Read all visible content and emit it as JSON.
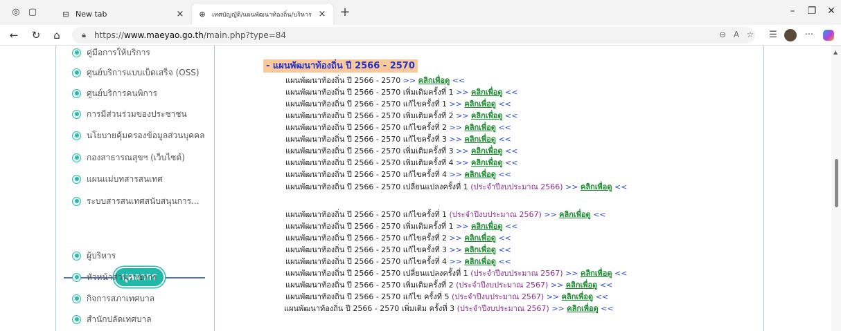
{
  "browser": {
    "tabs": [
      {
        "title": "New tab",
        "icon": "new-tab-icon"
      },
      {
        "title": "เทศบัญญัติ/แผนพัฒนาท้องถิ่น/บริหาร",
        "icon": "globe-icon"
      }
    ],
    "url_prefix": "https://",
    "url_domain": "www.maeyao.go.th",
    "url_path": "/main.php?type=84"
  },
  "sidebar": {
    "items_top": [
      "คู่มือการให้บริการ",
      "ศูนย์บริการแบบเบ็ดเสร็จ (OSS)",
      "ศูนย์บริการคนพิการ",
      "การมีส่วนร่วมของประชาชน",
      "นโยบายคุ้มครองข้อมูลส่วนบุคคล",
      "กองสาธารณสุขฯ (เว็บไซต์)",
      "แผนแม่บทสารสนเทศ",
      "ระบบสารสนเทศสนับสนุนการ..."
    ],
    "section_title": "บุคลากร",
    "items_bottom": [
      "ผู้บริหาร",
      "หัวหน้าส่วนราชการ",
      "กิจการสภาเทศบาล",
      "สำนักปลัดเทศบาล"
    ]
  },
  "main": {
    "title": "- แผนพัฒนาท้องถิ่น ปี 2566 - 2570",
    "rows": [
      {
        "text": "แผนพัฒนาท้องถิ่น ปี 2566 - 2570",
        "note": "",
        "arrow_l": ">>",
        "click": "คลิกเพื่อดู",
        "arrow_r": "<<"
      },
      {
        "text": "แผนพัฒนาท้องถิ่น ปี 2566 - 2570 เพิ่มเติมครั้งที่ 1",
        "note": "",
        "arrow_l": ">>",
        "click": "คลิกเพื่อดู",
        "arrow_r": "<<"
      },
      {
        "text": "แผนพัฒนาท้องถิ่น ปี 2566 - 2570 แก้ไขครั้งที่ 1",
        "note": "",
        "arrow_l": ">>",
        "click": "คลิกเพื่อดู",
        "arrow_r": "<<"
      },
      {
        "text": "แผนพัฒนาท้องถิ่น ปี 2566 - 2570 เพิ่มเติมครั้งที่ 2",
        "note": "",
        "arrow_l": ">>",
        "click": "คลิกเพื่อดู",
        "arrow_r": "<<"
      },
      {
        "text": "แผนพัฒนาท้องถิ่น ปี 2566 - 2570 แก้ไขครั้งที่ 2",
        "note": "",
        "arrow_l": ">>",
        "click": "คลิกเพื่อดู",
        "arrow_r": "<<"
      },
      {
        "text": "แผนพัฒนาท้องถิ่น ปี 2566 - 2570 แก้ไขครั้งที่ 3",
        "note": "",
        "arrow_l": ">>",
        "click": "คลิกเพื่อดู",
        "arrow_r": "<<"
      },
      {
        "text": "แผนพัฒนาท้องถิ่น ปี 2566 - 2570 เพิ่มเติมครั้งที่ 3",
        "note": "",
        "arrow_l": ">>",
        "click": "คลิกเพื่อดู",
        "arrow_r": "<<"
      },
      {
        "text": "แผนพัฒนาท้องถิ่น ปี 2566 - 2570 เพิ่มเติมครั้งที่ 4",
        "note": "",
        "arrow_l": ">>",
        "click": "คลิกเพื่อดู",
        "arrow_r": "<<"
      },
      {
        "text": "แผนพัฒนาท้องถิ่น ปี 2566 - 2570 แก้ไขครั้งที่ 4",
        "note": "",
        "arrow_l": ">>",
        "click": "คลิกเพื่อดู",
        "arrow_r": "<<"
      },
      {
        "text": "แผนพัฒนาท้องถิ่น ปี 2566 - 2570 เปลี่ยนแปลงครั้งที่ 1",
        "note": "(ประจำปีงบประมาณ 2566)",
        "arrow_l": ">>",
        "click": "คลิกเพื่อดู",
        "arrow_r": "<<"
      },
      {
        "text": "แผนพัฒนาท้องถิ่น ปี 2566 - 2570 แก้ไขครั้งที่ 1",
        "note": "(ประจำปีงบประมาณ 2567)",
        "arrow_l": ">>",
        "click": "คลิกเพื่อดู",
        "arrow_r": "<<"
      },
      {
        "text": "แผนพัฒนาท้องถิ่น ปี 2566 - 2570 เพิ่มเติมครั้งที่ 1",
        "note": "",
        "arrow_l": ">>",
        "click": "คลิกเพื่อดู",
        "arrow_r": "<<"
      },
      {
        "text": "แผนพัฒนาท้องถิ่น ปี 2566 - 2570 แก้ไขครั้งที่ 2",
        "note": "",
        "arrow_l": ">>",
        "click": "คลิกเพื่อดู",
        "arrow_r": "<<"
      },
      {
        "text": "แผนพัฒนาท้องถิ่น ปี 2566 - 2570 แก้ไขครั้งที่ 3",
        "note": "",
        "arrow_l": ">>",
        "click": "คลิกเพื่อดู",
        "arrow_r": "<<"
      },
      {
        "text": "แผนพัฒนาท้องถิ่น ปี 2566 - 2570 แก้ไขครั้งที่ 4",
        "note": "",
        "arrow_l": ">>",
        "click": "คลิกเพื่อดู",
        "arrow_r": "<<"
      },
      {
        "text": "แผนพัฒนาท้องถิ่น ปี 2566 - 2570 เปลี่ยนแปลงครั้งที่ 1",
        "note": "(ประจำปีงบประมาณ 2567)",
        "arrow_l": ">>",
        "click": "คลิกเพื่อดู",
        "arrow_r": "<<"
      },
      {
        "text": "แผนพัฒนาท้องถิ่น ปี 2566 - 2570 เพิ่มเติมครั้งที่ 2",
        "note": "(ประจำปีงบประมาณ 2567)",
        "arrow_l": ">>",
        "click": "คลิกเพื่อดู",
        "arrow_r": "<<"
      },
      {
        "text": "แผนพัฒนาท้องถิ่น ปี 2566 - 2570 แก้ไข ครั้งที่ 5",
        "note": "(ประจำปีงบประมาณ 2567)",
        "arrow_l": ">>",
        "click": "คลิกเพื่อดู",
        "arrow_r": "<<"
      },
      {
        "text": "แผนพัฒนาท้องถิ่น ปี 2566 - 2570 เพิ่มเติม ครั้งที่ 3",
        "note": "(ประจำปีงบประมาณ 2567)",
        "arrow_l": ">>",
        "click": "คลิกเพื่อดู",
        "arrow_r": "<<"
      }
    ]
  }
}
